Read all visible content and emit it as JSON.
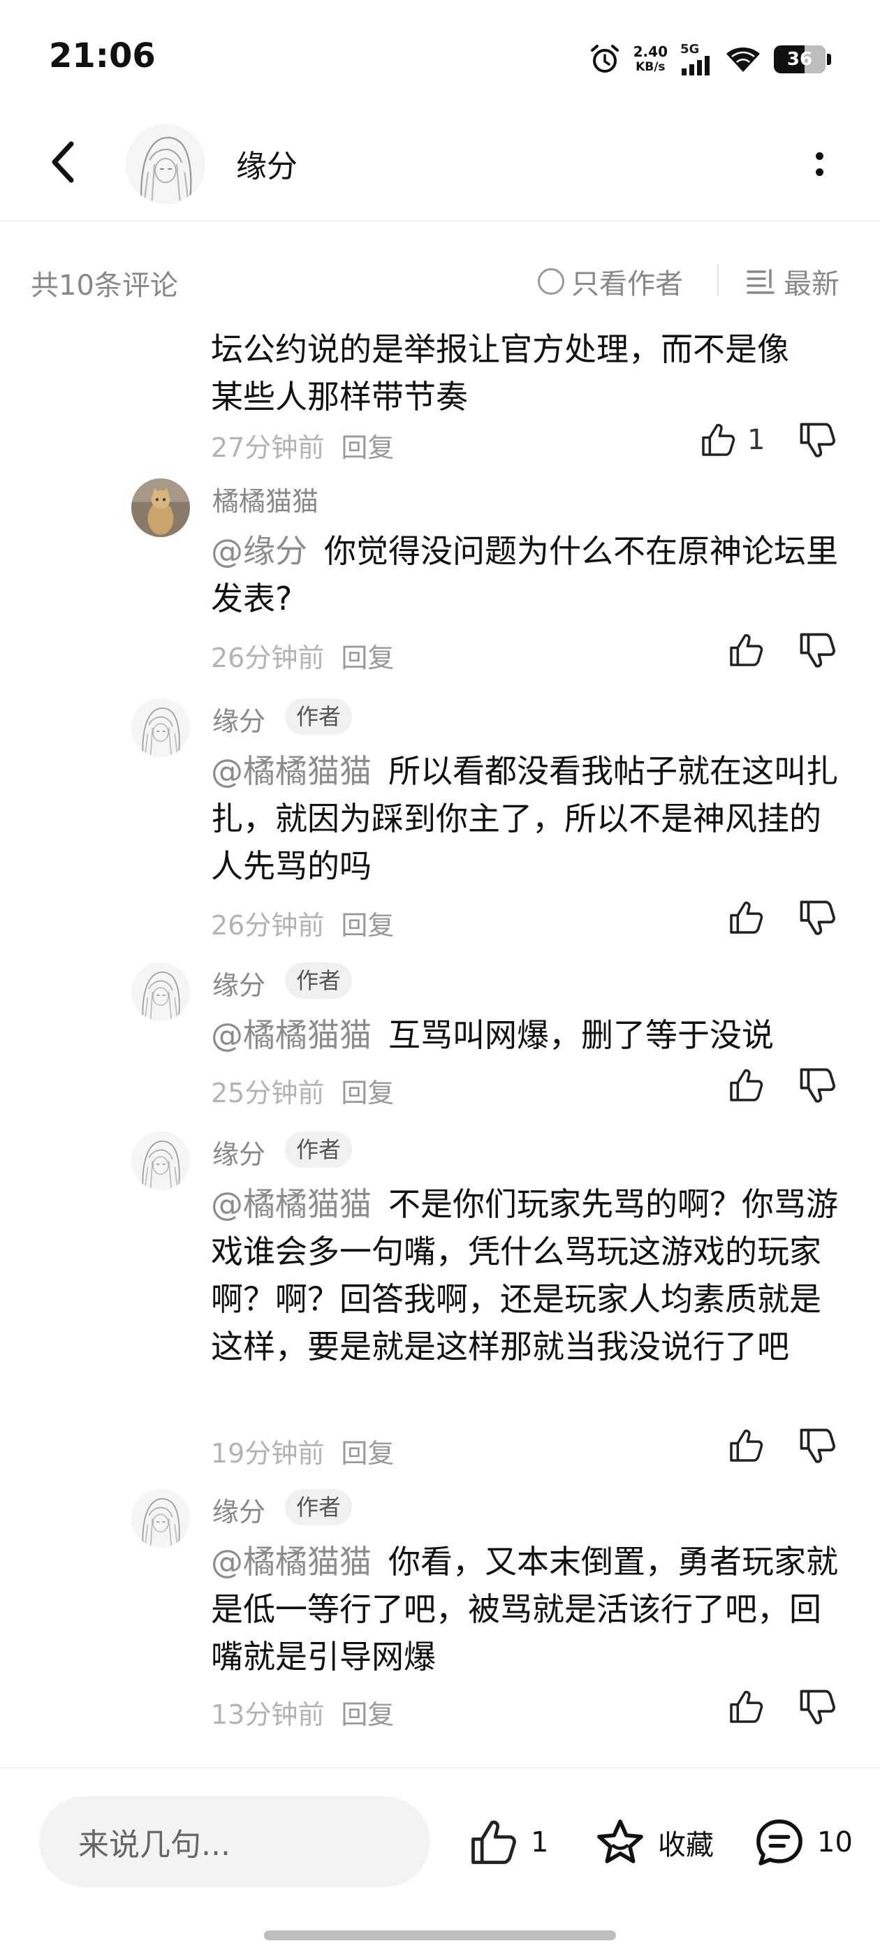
{
  "status_bar": {
    "time": "21:06",
    "net_speed_value": "2.40",
    "net_speed_unit": "KB/s",
    "network": "5G",
    "battery": "36",
    "icons": [
      "alarm-icon",
      "signal-icon",
      "wifi-icon",
      "battery-icon"
    ]
  },
  "header": {
    "title": "缘分",
    "icons": [
      "back-icon",
      "avatar",
      "more-icon"
    ]
  },
  "comment_bar": {
    "count_label": "共10条评论",
    "only_author_label": "只看作者",
    "sort_label": "最新"
  },
  "comments": [
    {
      "body_lines": [
        "坛公约说的是举报让官方处理，而不是像",
        "某些人那样带节奏"
      ],
      "time": "27分钟前",
      "reply": "回复",
      "likes": "1"
    },
    {
      "name": "橘橘猫猫",
      "mention": "@缘分",
      "body": "你觉得没问题为什么不在原神论坛里发表?",
      "time": "26分钟前",
      "reply": "回复"
    },
    {
      "name": "缘分",
      "tag": "作者",
      "mention": "@橘橘猫猫",
      "body": "所以看都没看我帖子就在这叫扎扎，就因为踩到你主了，所以不是神风挂的人先骂的吗",
      "time": "26分钟前",
      "reply": "回复"
    },
    {
      "name": "缘分",
      "tag": "作者",
      "mention": "@橘橘猫猫",
      "body": "互骂叫网爆，删了等于没说",
      "time": "25分钟前",
      "reply": "回复"
    },
    {
      "name": "缘分",
      "tag": "作者",
      "mention": "@橘橘猫猫",
      "body": "不是你们玩家先骂的啊？你骂游戏谁会多一句嘴，凭什么骂玩这游戏的玩家啊？啊？回答我啊，还是玩家人均素质就是这样，要是就是这样那就当我没说行了吧",
      "time": "19分钟前",
      "reply": "回复"
    },
    {
      "name": "缘分",
      "tag": "作者",
      "mention": "@橘橘猫猫",
      "body": "你看，又本末倒置，勇者玩家就是低一等行了吧，被骂就是活该行了吧，回嘴就是引导网爆",
      "time": "13分钟前",
      "reply": "回复"
    }
  ],
  "bottom_bar": {
    "input_placeholder": "来说几句...",
    "like_count": "1",
    "favorite_label": "收藏",
    "comment_count": "10"
  },
  "colors": {
    "text_primary": "#111111",
    "text_secondary": "#888888",
    "text_meta": "#b3b3b3",
    "input_bg": "#f3f3f3"
  }
}
